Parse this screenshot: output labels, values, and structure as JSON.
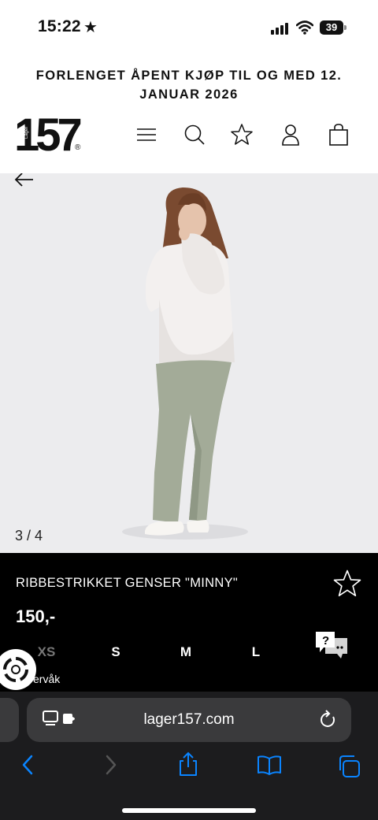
{
  "status_bar": {
    "time": "15:22",
    "star": "★",
    "battery": "39"
  },
  "promo": {
    "line1": "FORLENGET ÅPENT KJØP TIL OG MED 12.",
    "line2": "JANUAR 2026"
  },
  "header": {
    "logo": "157",
    "logo_sub": "Lager",
    "logo_reg": "®"
  },
  "gallery": {
    "counter": "3 / 4"
  },
  "product": {
    "name": "RIBBESTRIKKET GENSER \"MINNY\"",
    "price": "150,-",
    "sizes": [
      "XS",
      "S",
      "M",
      "L"
    ]
  },
  "widget": {
    "label": "ervåk"
  },
  "browser": {
    "url": "lager157.com"
  },
  "colors": {
    "background": "#ffffff",
    "image_bg": "#ececee",
    "info_bg": "#000000",
    "toolbar_bg": "#1c1c1e",
    "ios_blue": "#0a84ff",
    "sweater": "#f3f0ef",
    "pants": "#a3ab98"
  },
  "icons": {
    "header": [
      "menu-icon",
      "search-icon",
      "star-icon",
      "user-icon",
      "bag-icon"
    ],
    "toolbar": [
      "back-icon",
      "forward-icon",
      "share-icon",
      "bookmarks-icon",
      "tabs-icon"
    ]
  }
}
